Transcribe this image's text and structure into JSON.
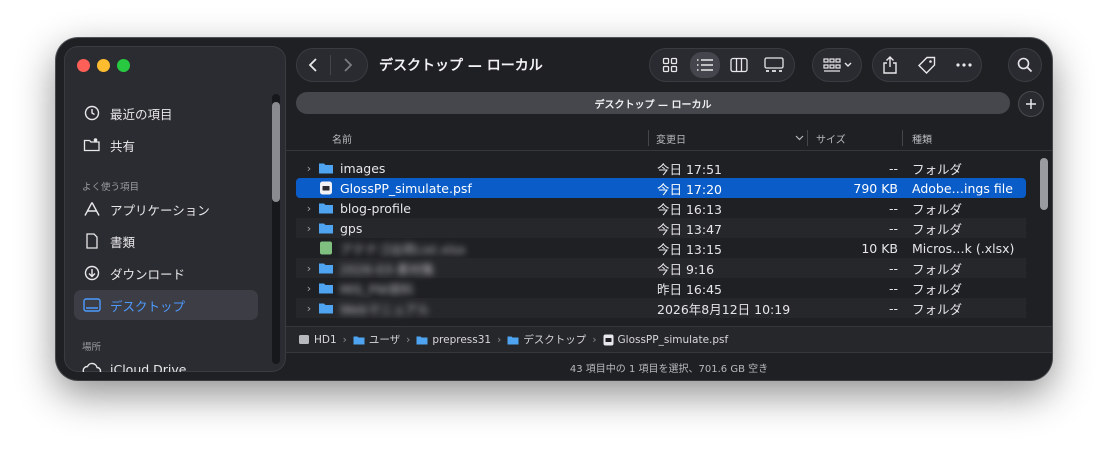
{
  "window": {
    "title": "デスクトップ — ローカル",
    "path_title": "デスクトップ — ローカル"
  },
  "sidebar": {
    "items": [
      {
        "label": "最近の項目",
        "icon": "clock-icon"
      },
      {
        "label": "共有",
        "icon": "shared-folder-icon"
      },
      {
        "label": "アプリケーション",
        "icon": "applications-icon"
      },
      {
        "label": "書類",
        "icon": "document-icon"
      },
      {
        "label": "ダウンロード",
        "icon": "download-icon"
      },
      {
        "label": "デスクトップ",
        "icon": "desktop-icon"
      },
      {
        "label": "iCloud Drive",
        "icon": "cloud-icon"
      }
    ],
    "sections": {
      "favorites": "よく使う項目",
      "locations": "場所"
    }
  },
  "columns": {
    "name": "名前",
    "date": "変更日",
    "size": "サイズ",
    "kind": "種類"
  },
  "files": [
    {
      "name": "images",
      "date": "今日 17:51",
      "size": "--",
      "kind": "フォルダ",
      "type": "folder"
    },
    {
      "name": "GlossPP_simulate.psf",
      "date": "今日 17:20",
      "size": "790 KB",
      "kind": "Adobe…ings file",
      "type": "file",
      "selected": true
    },
    {
      "name": "blog-profile",
      "date": "今日 16:13",
      "size": "--",
      "kind": "フォルダ",
      "type": "folder"
    },
    {
      "name": "gps",
      "date": "今日 13:47",
      "size": "--",
      "kind": "フォルダ",
      "type": "folder"
    },
    {
      "name": "アテナゴ出荷List.xlsx",
      "date": "今日 13:15",
      "size": "10 KB",
      "kind": "Micros…k (.xlsx)",
      "type": "excel",
      "blurred": true
    },
    {
      "name": "2026-03-素材集",
      "date": "今日 9:16",
      "size": "--",
      "kind": "フォルダ",
      "type": "folder",
      "blurred": true
    },
    {
      "name": "MIS_PW資料",
      "date": "昨日 16:45",
      "size": "--",
      "kind": "フォルダ",
      "type": "folder",
      "blurred": true
    },
    {
      "name": "Webマニュアル",
      "date": "2026年8月12日 10:19",
      "size": "--",
      "kind": "フォルダ",
      "type": "folder",
      "blurred": true
    }
  ],
  "breadcrumbs": [
    "HD1",
    "ユーザ",
    "prepress31",
    "デスクトップ",
    "GlossPP_simulate.psf"
  ],
  "status": "43 項目中の 1 項目を選択、701.6 GB 空き",
  "colors": {
    "selection": "#0a5dc9",
    "accent": "#4d9aff",
    "folder": "#4ea4f0"
  }
}
